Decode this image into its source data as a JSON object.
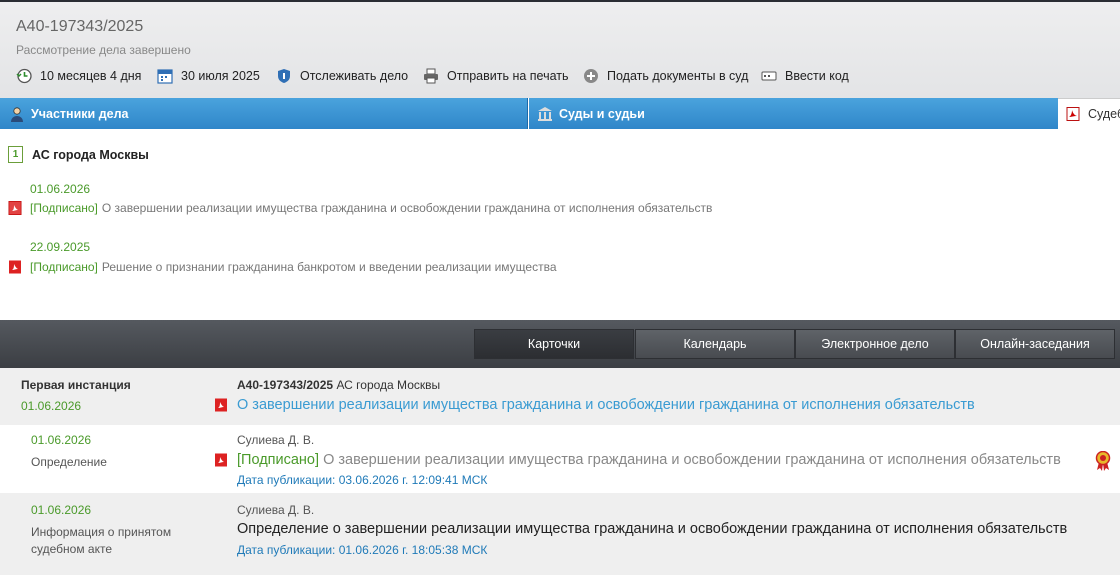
{
  "header": {
    "case_number": "А40-197343/2025",
    "status": "Рассмотрение дела завершено",
    "toolbar": [
      {
        "label": "10 месяцев 4 дня",
        "icon": "clock-back-icon"
      },
      {
        "label": "30 июля 2025",
        "icon": "calendar-icon"
      },
      {
        "label": "Отслеживать дело",
        "icon": "shield-icon"
      },
      {
        "label": "Отправить на печать",
        "icon": "printer-icon"
      },
      {
        "label": "Подать документы в суд",
        "icon": "plus-circle-icon"
      },
      {
        "label": "Ввести код",
        "icon": "code-icon"
      }
    ]
  },
  "tabs": [
    {
      "label": "Участники дела",
      "icon": "person-icon"
    },
    {
      "label": "Суды и судьи",
      "icon": "court-building-icon"
    },
    {
      "label": "Судеб",
      "icon": "pdf-icon"
    }
  ],
  "court": {
    "instance_badge": "1",
    "name": "АС города Москвы"
  },
  "documents": [
    {
      "date": "01.06.2026",
      "signed": "[Подписано]",
      "title": "О завершении реализации имущества гражданина и освобождении гражданина от исполнения обязательств"
    },
    {
      "date": "22.09.2025",
      "signed": "[Подписано]",
      "title": "Решение о признании гражданина банкротом и введении реализации имущества"
    }
  ],
  "view_tabs": [
    "Карточки",
    "Календарь",
    "Электронное дело",
    "Онлайн-заседания"
  ],
  "colors": {
    "accent_blue": "#3a9bd2",
    "green": "#4a9a2a",
    "dark_bar": "#3b3e43"
  },
  "instance": {
    "label": "Первая инстанция",
    "date": "01.06.2026",
    "case_number": "А40-197343/2025",
    "court": "АС города Москвы",
    "title": "О завершении реализации имущества гражданина и освобождении гражданина от исполнения обязательств"
  },
  "entries": [
    {
      "date": "01.06.2026",
      "type": "Определение",
      "judge": "Сулиева Д. В.",
      "signed": "[Подписано]",
      "title": "О завершении реализации имущества гражданина и освобождении гражданина от исполнения обязательств",
      "pubdate": "Дата публикации: 03.06.2026 г. 12:09:41 МСК"
    },
    {
      "date": "01.06.2026",
      "type": "Информация о принятом судебном акте",
      "judge": "Сулиева Д. В.",
      "title": "Определение о завершении реализации имущества гражданина и освобождении гражданина от исполнения обязательств",
      "pubdate": "Дата публикации: 01.06.2026 г. 18:05:38 МСК"
    }
  ]
}
